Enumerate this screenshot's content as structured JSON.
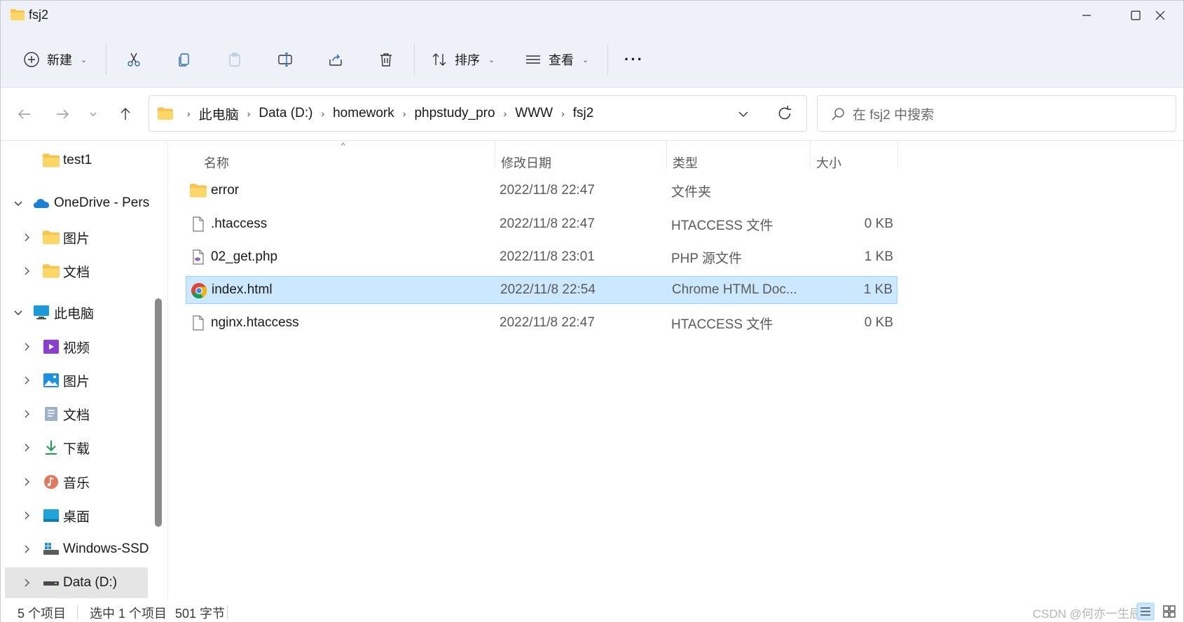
{
  "window": {
    "title": "fsj2"
  },
  "toolbar": {
    "new_label": "新建",
    "sort_label": "排序",
    "view_label": "查看",
    "more_label": "···"
  },
  "address": {
    "crumbs": [
      "此电脑",
      "Data (D:)",
      "homework",
      "phpstudy_pro",
      "WWW",
      "fsj2"
    ],
    "search_placeholder": "在 fsj2 中搜索"
  },
  "sidebar": {
    "items": [
      {
        "label": "test1",
        "icon": "folder-icon"
      },
      {
        "label": "OneDrive - Pers",
        "icon": "onedrive-icon"
      },
      {
        "label": "图片",
        "icon": "folder-icon"
      },
      {
        "label": "文档",
        "icon": "folder-icon"
      },
      {
        "label": "此电脑",
        "icon": "computer-icon"
      },
      {
        "label": "视频",
        "icon": "videos-icon"
      },
      {
        "label": "图片",
        "icon": "pictures-icon"
      },
      {
        "label": "文档",
        "icon": "documents-icon"
      },
      {
        "label": "下载",
        "icon": "downloads-icon"
      },
      {
        "label": "音乐",
        "icon": "music-icon"
      },
      {
        "label": "桌面",
        "icon": "desktop-icon"
      },
      {
        "label": "Windows-SSD",
        "icon": "drive-windows-icon"
      },
      {
        "label": "Data (D:)",
        "icon": "drive-icon"
      }
    ]
  },
  "filelist": {
    "columns": [
      "名称",
      "修改日期",
      "类型",
      "大小"
    ],
    "rows": [
      {
        "name": "error",
        "date": "2022/11/8 22:47",
        "type": "文件夹",
        "size": "",
        "icon": "folder-icon"
      },
      {
        "name": ".htaccess",
        "date": "2022/11/8 22:47",
        "type": "HTACCESS 文件",
        "size": "0 KB",
        "icon": "file-icon"
      },
      {
        "name": "02_get.php",
        "date": "2022/11/8 23:01",
        "type": "PHP 源文件",
        "size": "1 KB",
        "icon": "php-file-icon"
      },
      {
        "name": "index.html",
        "date": "2022/11/8 22:54",
        "type": "Chrome HTML Doc...",
        "size": "1 KB",
        "icon": "chrome-icon"
      },
      {
        "name": "nginx.htaccess",
        "date": "2022/11/8 22:47",
        "type": "HTACCESS 文件",
        "size": "0 KB",
        "icon": "file-icon"
      }
    ]
  },
  "status": {
    "item_count": "5 个项目",
    "selection": "选中 1 个项目",
    "size": "501 字节",
    "watermark": "CSDN @何亦一生辰"
  },
  "colors": {
    "selection_bg": "#cce8ff",
    "selection_border": "#99d1ff",
    "chrome_bg": "#eef1f7",
    "folder_yellow": "#f8c44f"
  }
}
